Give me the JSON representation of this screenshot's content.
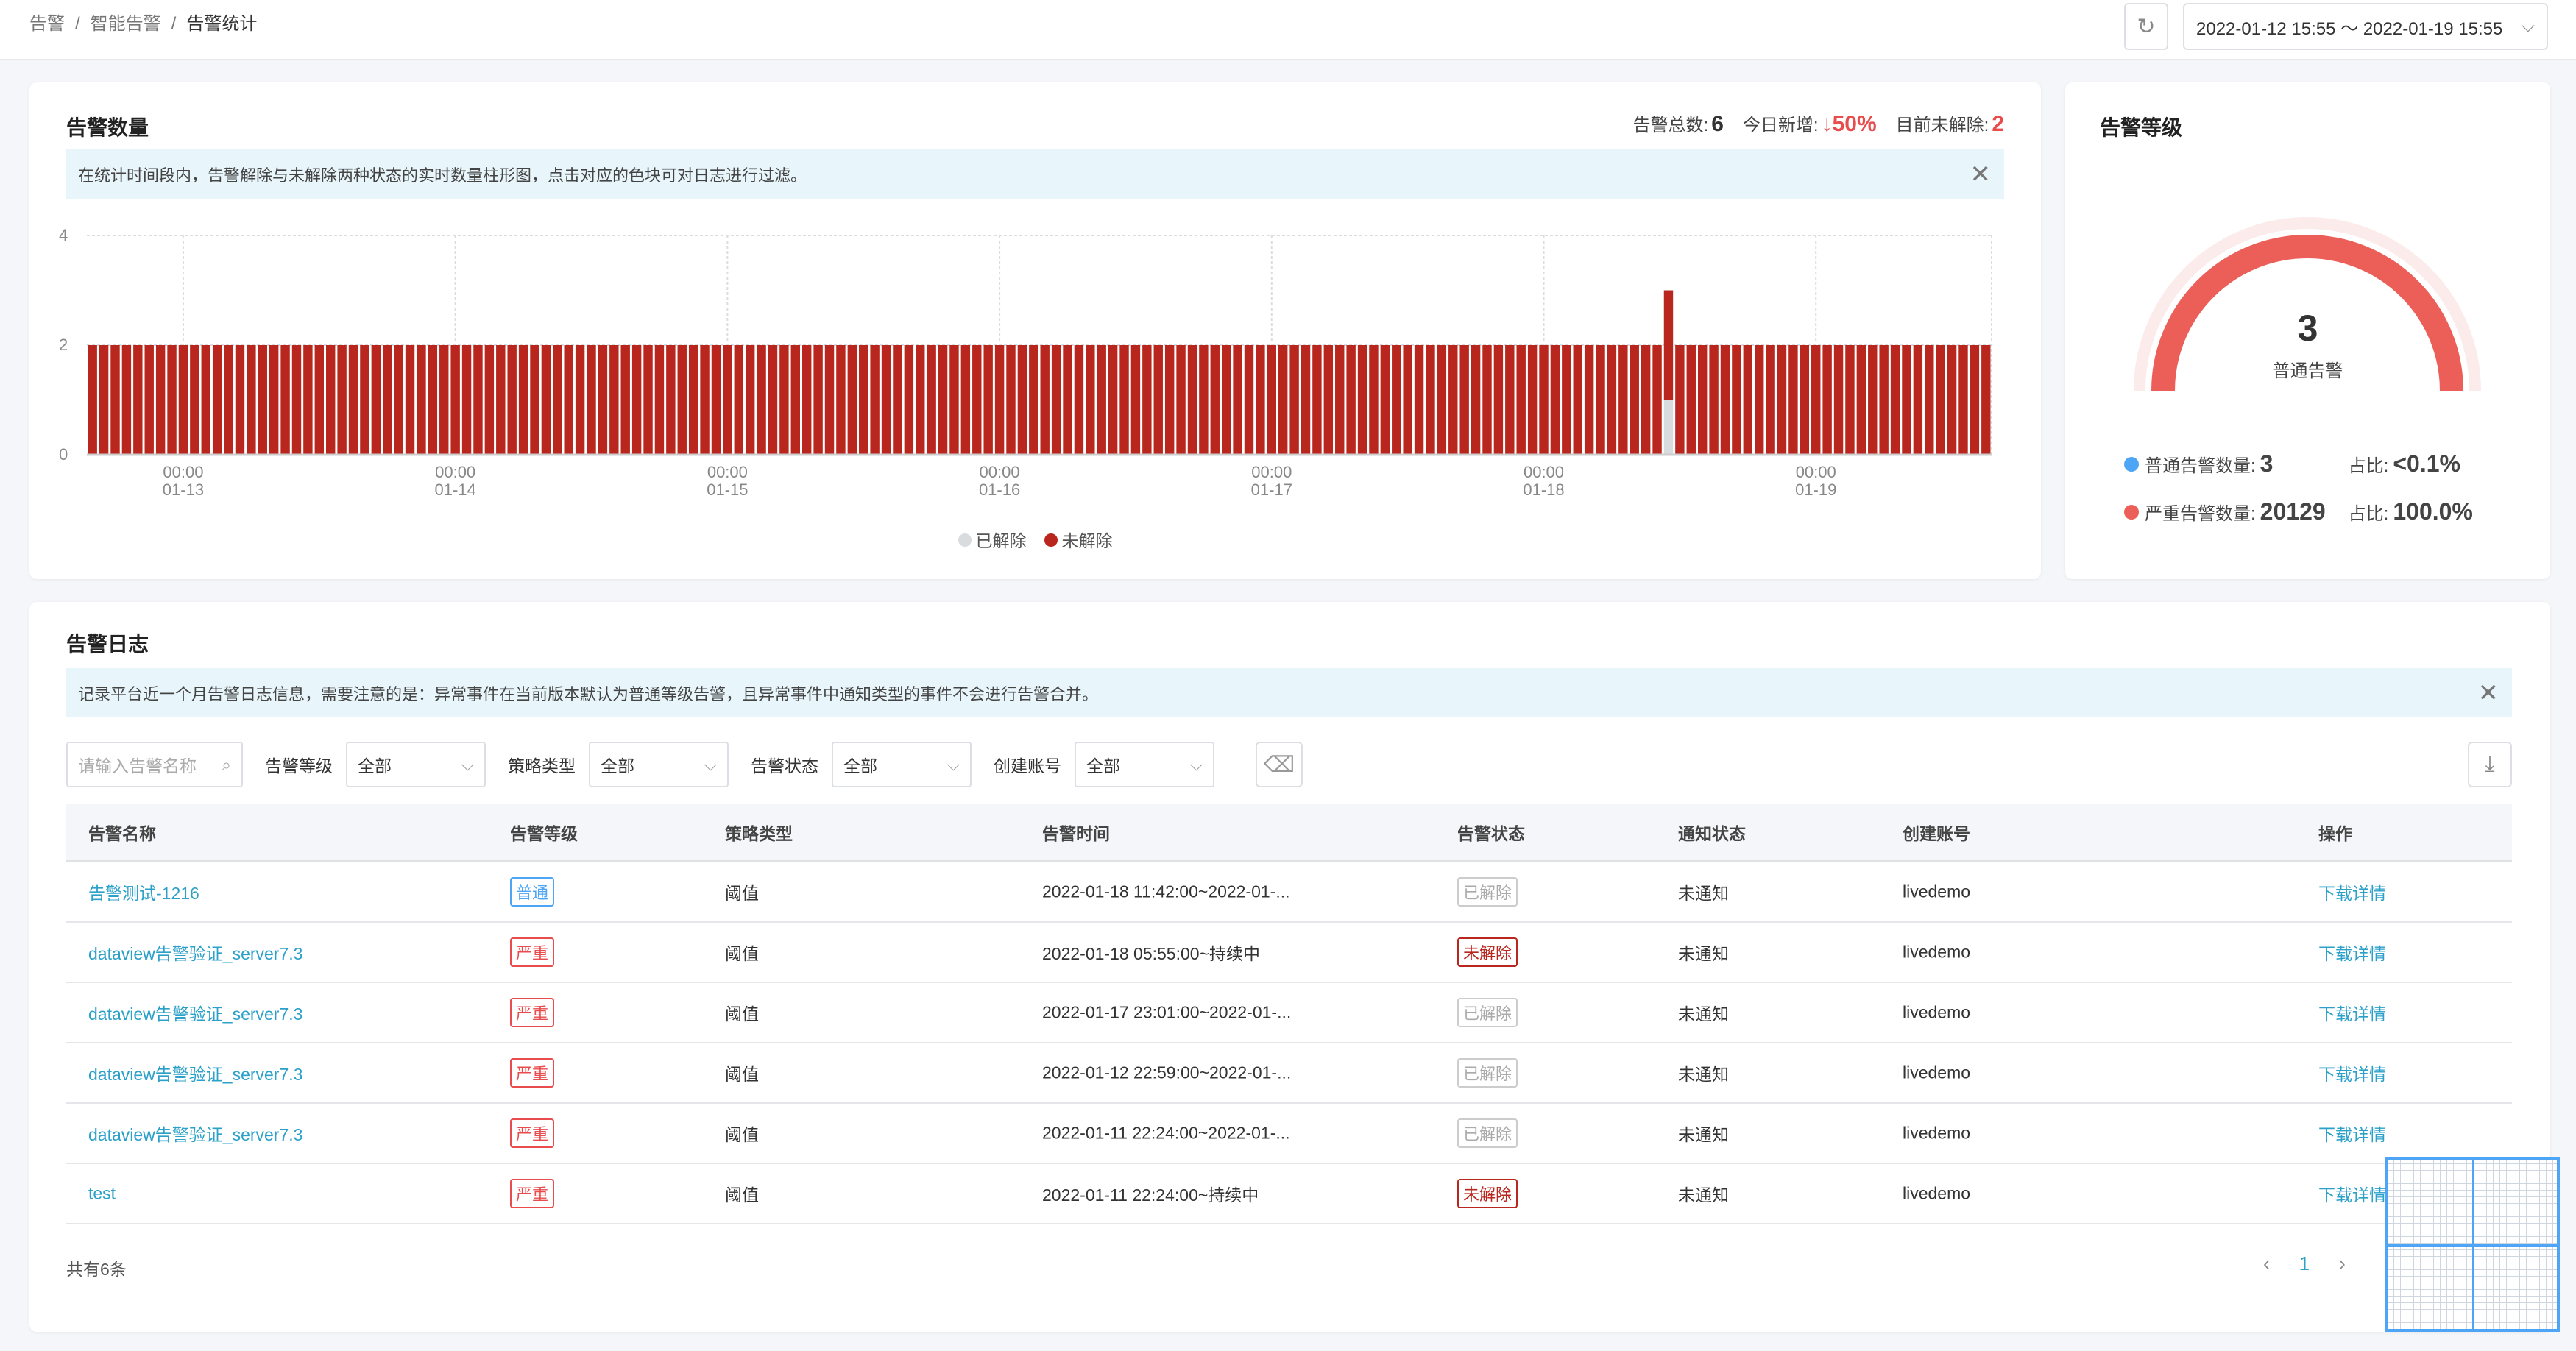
{
  "breadcrumb": [
    "告警",
    "智能告警",
    "告警统计"
  ],
  "date_range": "2022-01-12 15:55 ～ 2022-01-19 15:55",
  "colors": {
    "unresolved": "#b8261e",
    "resolved": "#d9dcdf",
    "gauge": "#ec5f59",
    "gauge_bg": "#fcebeb",
    "normal_dot": "#4ea5f5",
    "severe_dot": "#ec5f59",
    "link": "#2ba0c8",
    "down": "#e84c4c"
  },
  "count_panel": {
    "title": "告警数量",
    "stats": {
      "total_label": "告警总数:",
      "total": "6",
      "new_label": "今日新增:",
      "new": "↓50%",
      "open_label": "目前未解除:",
      "open": "2"
    },
    "banner": "在统计时间段内，告警解除与未解除两种状态的实时数量柱形图，点击对应的色块可对日志进行过滤。"
  },
  "chart_data": {
    "type": "bar",
    "stacked": true,
    "x_start": "2022-01-12 16:00",
    "x_end": "2022-01-19 15:00",
    "interval": "1h",
    "ylim": [
      0,
      4
    ],
    "yticks": [
      "0",
      "2",
      "4"
    ],
    "xticks": [
      [
        "00:00",
        "01-13"
      ],
      [
        "00:00",
        "01-14"
      ],
      [
        "00:00",
        "01-15"
      ],
      [
        "00:00",
        "01-16"
      ],
      [
        "00:00",
        "01-17"
      ],
      [
        "00:00",
        "01-18"
      ],
      [
        "00:00",
        "01-19"
      ]
    ],
    "series": [
      {
        "name": "已解除",
        "default": 0,
        "exceptions": [
          {
            "x": "2022-01-18 11:00",
            "value": 1
          }
        ]
      },
      {
        "name": "未解除",
        "default": 2,
        "exceptions": []
      }
    ],
    "legend_position": "bottom",
    "grid": true
  },
  "level_panel": {
    "title": "告警等级",
    "gauge_value": "3",
    "gauge_label": "普通告警",
    "normal_label": "普通告警数量:",
    "normal_count": "3",
    "normal_ratio_label": "占比:",
    "normal_ratio": "<0.1%",
    "severe_label": "严重告警数量:",
    "severe_count": "20129",
    "severe_ratio_label": "占比:",
    "severe_ratio": "100.0%"
  },
  "log_panel": {
    "title": "告警日志",
    "banner": "记录平台近一个月告警日志信息，需要注意的是：异常事件在当前版本默认为普通等级告警，且异常事件中通知类型的事件不会进行告警合并。",
    "search_placeholder": "请输入告警名称",
    "filters": [
      {
        "label": "告警等级",
        "value": "全部"
      },
      {
        "label": "策略类型",
        "value": "全部"
      },
      {
        "label": "告警状态",
        "value": "全部"
      },
      {
        "label": "创建账号",
        "value": "全部"
      }
    ],
    "columns": [
      "告警名称",
      "告警等级",
      "策略类型",
      "告警时间",
      "告警状态",
      "通知状态",
      "创建账号",
      "操作"
    ],
    "rows": [
      {
        "name": "告警测试-1216",
        "level": "普通",
        "level_type": "normal",
        "strategy": "阈值",
        "time": "2022-01-18 11:42:00~2022-01-...",
        "status": "已解除",
        "status_type": "resolved",
        "notify": "未通知",
        "account": "livedemo",
        "action": "下载详情"
      },
      {
        "name": "dataview告警验证_server7.3",
        "level": "严重",
        "level_type": "severe",
        "strategy": "阈值",
        "time": "2022-01-18 05:55:00~持续中",
        "status": "未解除",
        "status_type": "open",
        "notify": "未通知",
        "account": "livedemo",
        "action": "下载详情"
      },
      {
        "name": "dataview告警验证_server7.3",
        "level": "严重",
        "level_type": "severe",
        "strategy": "阈值",
        "time": "2022-01-17 23:01:00~2022-01-...",
        "status": "已解除",
        "status_type": "resolved",
        "notify": "未通知",
        "account": "livedemo",
        "action": "下载详情"
      },
      {
        "name": "dataview告警验证_server7.3",
        "level": "严重",
        "level_type": "severe",
        "strategy": "阈值",
        "time": "2022-01-12 22:59:00~2022-01-...",
        "status": "已解除",
        "status_type": "resolved",
        "notify": "未通知",
        "account": "livedemo",
        "action": "下载详情"
      },
      {
        "name": "dataview告警验证_server7.3",
        "level": "严重",
        "level_type": "severe",
        "strategy": "阈值",
        "time": "2022-01-11 22:24:00~2022-01-...",
        "status": "已解除",
        "status_type": "resolved",
        "notify": "未通知",
        "account": "livedemo",
        "action": "下载详情"
      },
      {
        "name": "test",
        "level": "严重",
        "level_type": "severe",
        "strategy": "阈值",
        "time": "2022-01-11 22:24:00~持续中",
        "status": "未解除",
        "status_type": "open",
        "notify": "未通知",
        "account": "livedemo",
        "action": "下载详情"
      }
    ],
    "total": "共有6条",
    "page": "1"
  }
}
